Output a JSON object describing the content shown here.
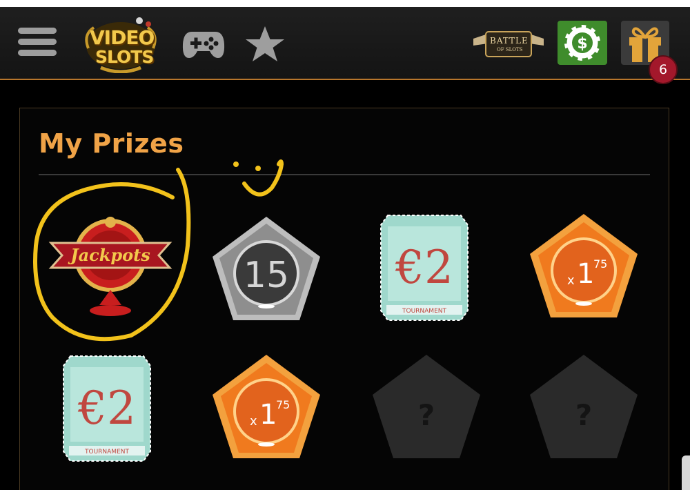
{
  "header": {
    "logo": {
      "line1": "VIDEO",
      "line2": "SLOTS"
    },
    "battle": {
      "line1": "BATTLE",
      "line2": "OF SLOTS"
    },
    "notifications_count": "6"
  },
  "prizes_panel": {
    "title": "My Prizes",
    "items": [
      {
        "kind": "jackpots",
        "label": "Jackpots"
      },
      {
        "kind": "spins",
        "value": "15"
      },
      {
        "kind": "tournament-ticket",
        "amount": "€2",
        "caption": "TOURNAMENT"
      },
      {
        "kind": "multiplier",
        "prefix": "x",
        "base": "1",
        "super": "75"
      },
      {
        "kind": "tournament-ticket",
        "amount": "€2",
        "caption": "TOURNAMENT"
      },
      {
        "kind": "multiplier",
        "prefix": "x",
        "base": "1",
        "super": "75"
      },
      {
        "kind": "locked",
        "symbol": "?"
      },
      {
        "kind": "locked",
        "symbol": "?"
      }
    ]
  },
  "colors": {
    "accent": "#f0a347",
    "header_border": "#b8762c",
    "scribble": "#f2c21b",
    "ticket": "#9fd8cc",
    "multiplier": "#f07a1e",
    "badge": "#a3182b"
  }
}
